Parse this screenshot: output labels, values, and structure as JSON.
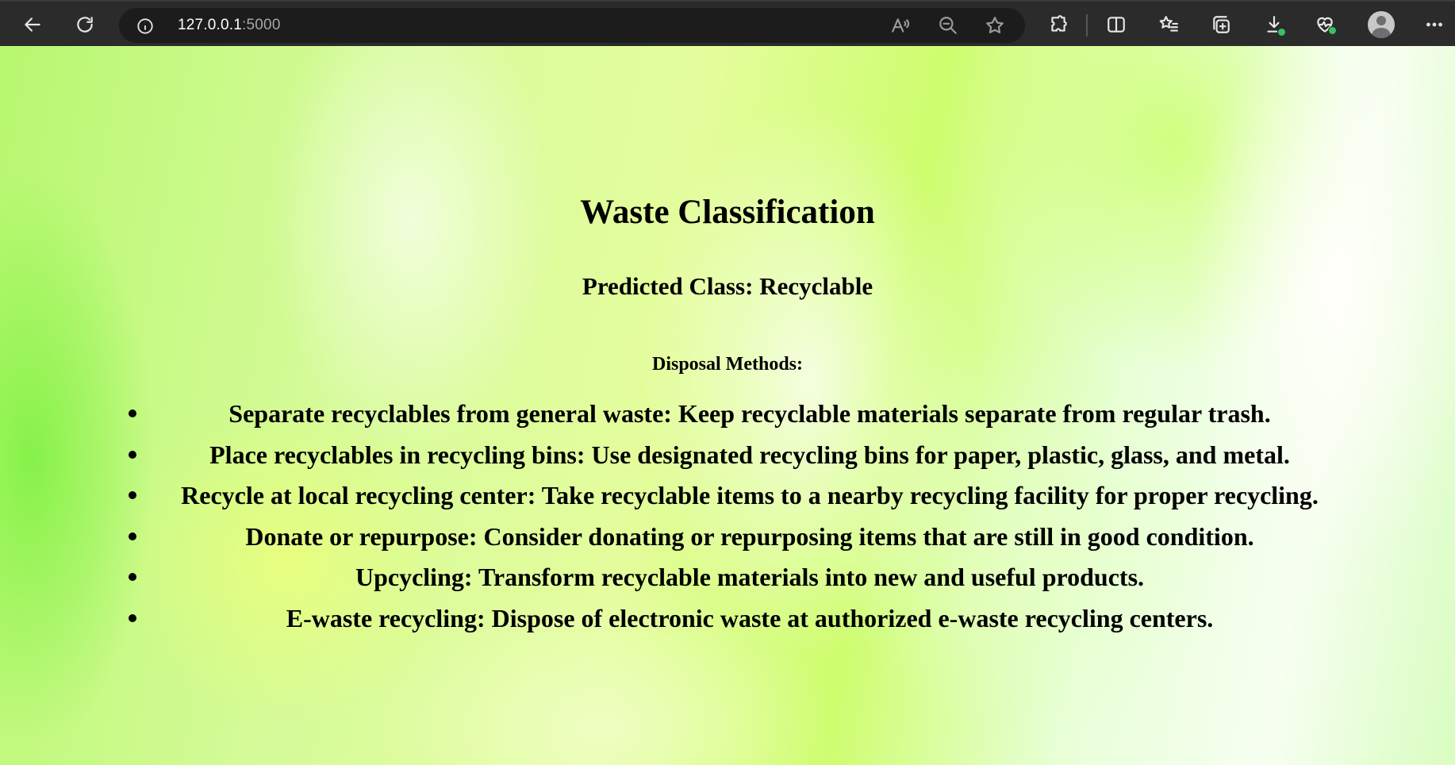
{
  "browser": {
    "url_host": "127.0.0.1",
    "url_port": ":5000"
  },
  "page": {
    "title": "Waste Classification",
    "predicted": "Predicted Class: Recyclable",
    "methods_heading": "Disposal Methods:",
    "methods": [
      "Separate recyclables from general waste: Keep recyclable materials separate from regular trash.",
      "Place recyclables in recycling bins: Use designated recycling bins for paper, plastic, glass, and metal.",
      "Recycle at local recycling center: Take recyclable items to a nearby recycling facility for proper recycling.",
      "Donate or repurpose: Consider donating or repurposing items that are still in good condition.",
      "Upcycling: Transform recyclable materials into new and useful products.",
      "E-waste recycling: Dispose of electronic waste at authorized e-waste recycling centers."
    ]
  }
}
